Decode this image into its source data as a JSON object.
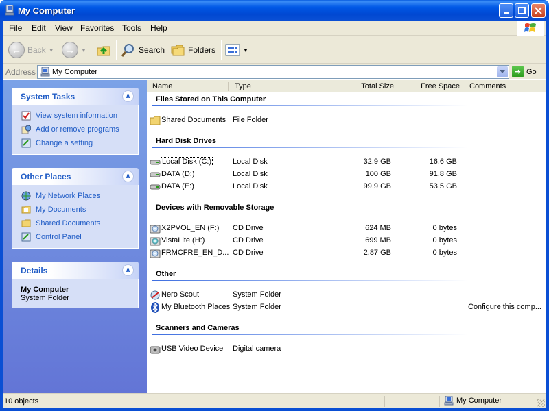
{
  "window": {
    "title": "My Computer"
  },
  "menu": [
    "File",
    "Edit",
    "View",
    "Favorites",
    "Tools",
    "Help"
  ],
  "toolbar": {
    "back": "Back",
    "search": "Search",
    "folders": "Folders"
  },
  "address": {
    "label": "Address",
    "value": "My Computer",
    "go": "Go"
  },
  "system_tasks": {
    "title": "System Tasks",
    "items": [
      "View system information",
      "Add or remove programs",
      "Change a setting"
    ]
  },
  "other_places": {
    "title": "Other Places",
    "items": [
      "My Network Places",
      "My Documents",
      "Shared Documents",
      "Control Panel"
    ]
  },
  "details": {
    "title": "Details",
    "name": "My Computer",
    "kind": "System Folder"
  },
  "columns": {
    "name": "Name",
    "type": "Type",
    "total": "Total Size",
    "free": "Free Space",
    "comments": "Comments"
  },
  "groups": [
    {
      "title": "Files Stored on This Computer",
      "items": [
        {
          "name": "Shared Documents",
          "type": "File Folder",
          "total": "",
          "free": "",
          "comment": ""
        }
      ]
    },
    {
      "title": "Hard Disk Drives",
      "items": [
        {
          "name": "Local Disk (C:)",
          "type": "Local Disk",
          "total": "32.9 GB",
          "free": "16.6 GB",
          "comment": ""
        },
        {
          "name": "DATA (D:)",
          "type": "Local Disk",
          "total": "100 GB",
          "free": "91.8 GB",
          "comment": ""
        },
        {
          "name": "DATA (E:)",
          "type": "Local Disk",
          "total": "99.9 GB",
          "free": "53.5 GB",
          "comment": ""
        }
      ]
    },
    {
      "title": "Devices with Removable Storage",
      "items": [
        {
          "name": "X2PVOL_EN (F:)",
          "type": "CD Drive",
          "total": "624 MB",
          "free": "0 bytes",
          "comment": ""
        },
        {
          "name": "VistaLite (H:)",
          "type": "CD Drive",
          "total": "699 MB",
          "free": "0 bytes",
          "comment": ""
        },
        {
          "name": "FRMCFRE_EN_D...",
          "type": "CD Drive",
          "total": "2.87 GB",
          "free": "0 bytes",
          "comment": ""
        }
      ]
    },
    {
      "title": "Other",
      "items": [
        {
          "name": "Nero Scout",
          "type": "System Folder",
          "total": "",
          "free": "",
          "comment": ""
        },
        {
          "name": "My Bluetooth Places",
          "type": "System Folder",
          "total": "",
          "free": "",
          "comment": "Configure this comp..."
        }
      ]
    },
    {
      "title": "Scanners and Cameras",
      "items": [
        {
          "name": "USB Video Device",
          "type": "Digital camera",
          "total": "",
          "free": "",
          "comment": ""
        }
      ]
    }
  ],
  "status": {
    "count": "10 objects",
    "location": "My Computer"
  }
}
